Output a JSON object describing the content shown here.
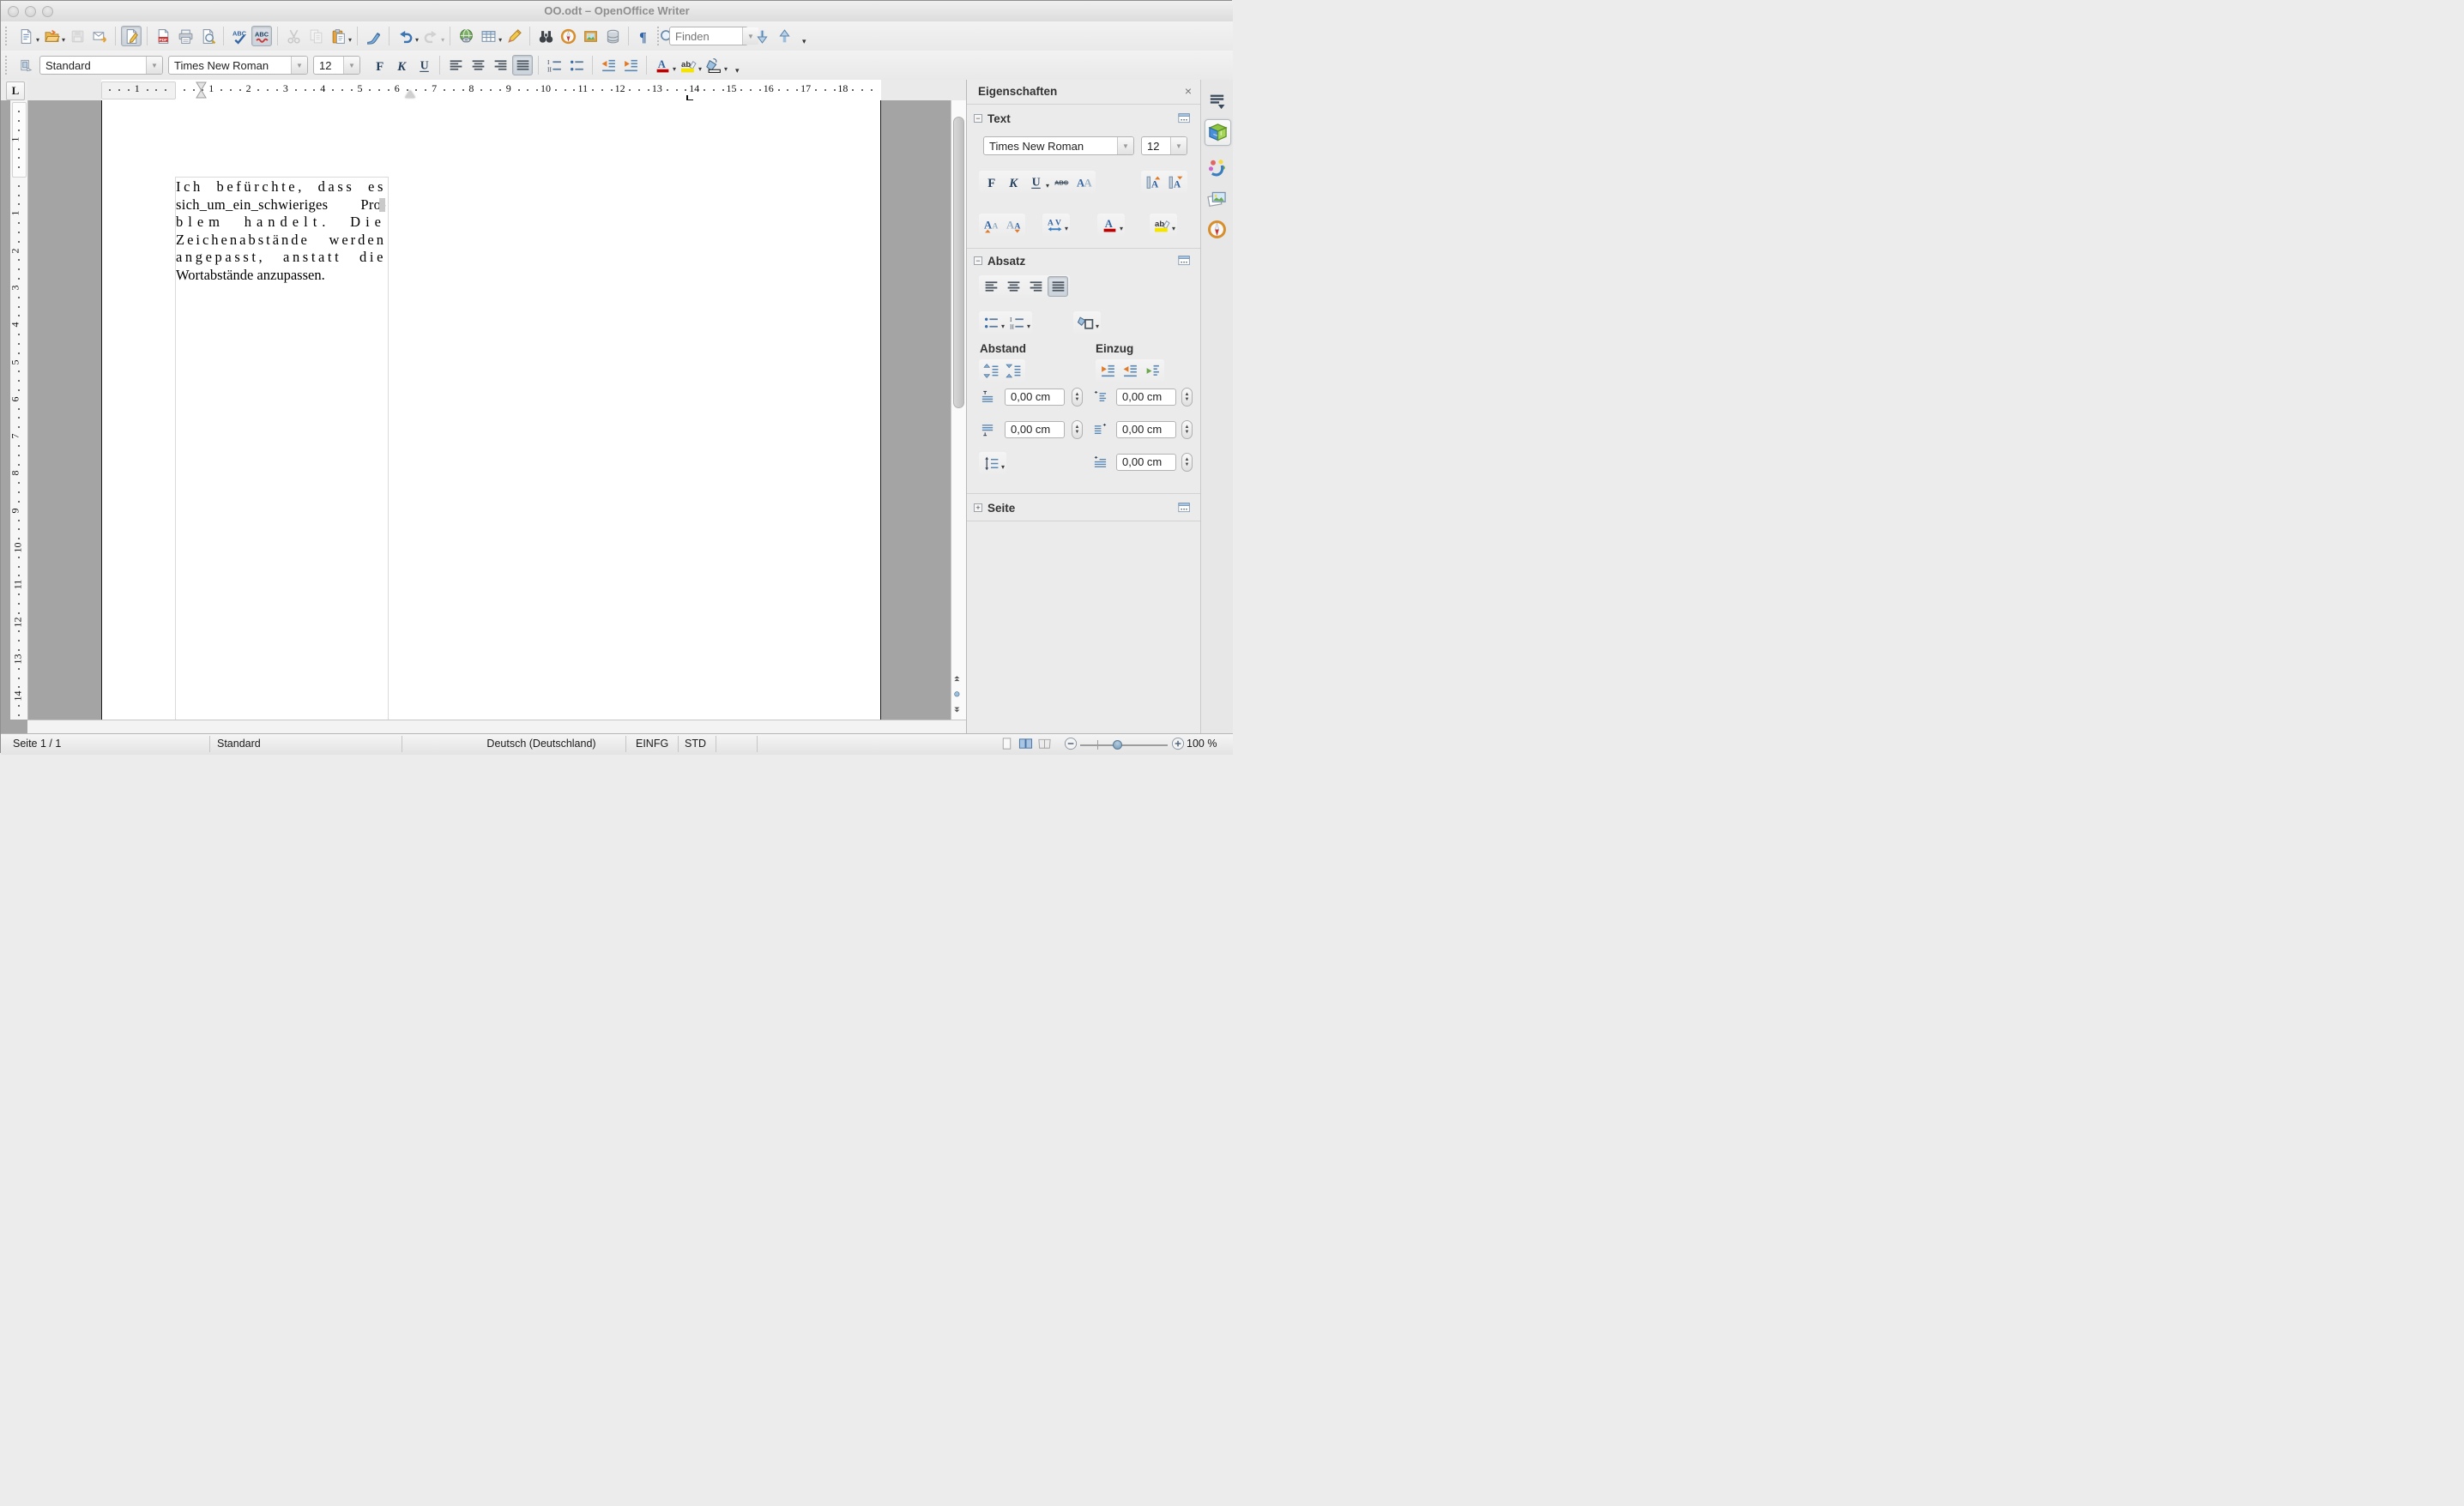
{
  "window": {
    "title": "OO.odt – OpenOffice Writer"
  },
  "toolbar_standard": {
    "buttons": [
      {
        "name": "new-document-button",
        "icon": "new-doc",
        "dropdown": true
      },
      {
        "name": "open-button",
        "icon": "open-folder",
        "dropdown": true
      },
      {
        "name": "save-button",
        "icon": "save-floppy",
        "disabled": true
      },
      {
        "name": "email-document-button",
        "icon": "email"
      },
      {
        "name": "edit-file-button",
        "icon": "edit-file",
        "active": true,
        "sep_before": true
      },
      {
        "name": "export-pdf-button",
        "icon": "pdf-doc",
        "sep_before": true
      },
      {
        "name": "print-button",
        "icon": "printer"
      },
      {
        "name": "page-preview-button",
        "icon": "page-preview"
      },
      {
        "name": "spellcheck-button",
        "icon": "spellcheck",
        "sep_before": true
      },
      {
        "name": "auto-spellcheck-button",
        "icon": "auto-spellcheck",
        "active": true
      },
      {
        "name": "cut-button",
        "icon": "scissors",
        "disabled": true,
        "sep_before": true
      },
      {
        "name": "copy-button",
        "icon": "copy-pages",
        "disabled": true
      },
      {
        "name": "paste-button",
        "icon": "clipboard",
        "dropdown": true
      },
      {
        "name": "clone-formatting-button",
        "icon": "paintbrush",
        "sep_before": true
      },
      {
        "name": "undo-button",
        "icon": "undo-arrow",
        "dropdown": true,
        "sep_before": true
      },
      {
        "name": "redo-button",
        "icon": "redo-arrow",
        "disabled": true,
        "dropdown": true
      },
      {
        "name": "hyperlink-button",
        "icon": "hyperlink-globe",
        "sep_before": true
      },
      {
        "name": "insert-table-button",
        "icon": "table-grid",
        "dropdown": true
      },
      {
        "name": "draw-functions-button",
        "icon": "draw-pencil"
      },
      {
        "name": "find-replace-button",
        "icon": "binoculars",
        "sep_before": true
      },
      {
        "name": "navigator-button",
        "icon": "navigator-compass"
      },
      {
        "name": "gallery-button",
        "icon": "gallery-picture"
      },
      {
        "name": "data-sources-button",
        "icon": "database"
      },
      {
        "name": "formatting-marks-button",
        "icon": "pilcrow",
        "sep_before": true
      },
      {
        "name": "zoom-button",
        "icon": "zoom-lens"
      },
      {
        "name": "help-button",
        "icon": "help-circle",
        "sep_before": true
      }
    ]
  },
  "find_bar": {
    "placeholder": "Finden",
    "buttons": [
      {
        "name": "find-next-button",
        "icon": "arrow-down-blue"
      },
      {
        "name": "find-previous-button",
        "icon": "arrow-up-blue"
      }
    ]
  },
  "toolbar_formatting": {
    "style_value": "Standard",
    "font_value": "Times New Roman",
    "size_value": "12",
    "buttons": [
      {
        "name": "bold-button",
        "icon": "bold-f"
      },
      {
        "name": "italic-button",
        "icon": "italic-k"
      },
      {
        "name": "underline-button",
        "icon": "underline-u"
      },
      {
        "name": "align-left-button",
        "icon": "align-left",
        "sep_before": true
      },
      {
        "name": "align-center-button",
        "icon": "align-center"
      },
      {
        "name": "align-right-button",
        "icon": "align-right"
      },
      {
        "name": "justify-button",
        "icon": "align-justify",
        "active": true
      },
      {
        "name": "numbered-list-button",
        "icon": "numbered-list",
        "sep_before": true
      },
      {
        "name": "bullet-list-button",
        "icon": "bullet-list"
      },
      {
        "name": "decrease-indent-button",
        "icon": "indent-decrease",
        "sep_before": true
      },
      {
        "name": "increase-indent-button",
        "icon": "indent-increase"
      },
      {
        "name": "font-color-button",
        "icon": "font-color",
        "dropdown": true,
        "sep_before": true
      },
      {
        "name": "highlighting-button",
        "icon": "highlight",
        "dropdown": true
      },
      {
        "name": "background-color-button",
        "icon": "paint-can",
        "dropdown": true
      }
    ]
  },
  "ruler": {
    "h_margin_number": "1",
    "h_numbers": [
      "1",
      "2",
      "3",
      "4",
      "5",
      "6",
      "7",
      "8",
      "9",
      "10",
      "11",
      "12",
      "13",
      "14",
      "15",
      "16",
      "17",
      "18"
    ],
    "v_margin_number": "1",
    "v_numbers": [
      "1",
      "2",
      "3",
      "4",
      "5",
      "6",
      "7",
      "8",
      "9",
      "10",
      "11",
      "12",
      "13",
      "14"
    ]
  },
  "document": {
    "lines": [
      {
        "text": "Ich befürchte, dass es",
        "ls": 3.6
      },
      {
        "text": "sich_um_ein_schwieriges Pro-",
        "ls": 0.3,
        "cursor": true
      },
      {
        "text": "blem handelt. Die",
        "ls": 6.0
      },
      {
        "text": "Zeichenabstände werden",
        "ls": 3.0
      },
      {
        "text": "angepasst, anstatt die",
        "ls": 3.6
      },
      {
        "text": "Wortabstände anzupassen.",
        "ls": 0,
        "last": true
      }
    ]
  },
  "sidebar": {
    "title": "Eigenschaften",
    "close_label": "×",
    "tabs": [
      {
        "name": "sidebar-menu-button",
        "icon": "sidebar-menu"
      },
      {
        "name": "tab-properties",
        "icon": "properties-cube",
        "active": true
      },
      {
        "name": "tab-styles",
        "icon": "styles-figures"
      },
      {
        "name": "tab-gallery",
        "icon": "gallery-photos"
      },
      {
        "name": "tab-navigator",
        "icon": "navigator-compass"
      }
    ],
    "text_section": {
      "label": "Text",
      "font_name": "Times New Roman",
      "font_size": "12",
      "buttons_row1": [
        {
          "name": "sidebar-bold-button",
          "icon": "bold-f"
        },
        {
          "name": "sidebar-italic-button",
          "icon": "italic-k"
        },
        {
          "name": "sidebar-underline-button",
          "icon": "underline-u",
          "dropdown": true
        },
        {
          "name": "sidebar-strikethrough-button",
          "icon": "strikethrough"
        },
        {
          "name": "sidebar-character-dialog-button",
          "icon": "char-aa"
        }
      ],
      "buttons_row1b": [
        {
          "name": "sidebar-superscript-button",
          "icon": "superscript"
        },
        {
          "name": "sidebar-subscript-button",
          "icon": "subscript"
        }
      ],
      "buttons_row2a": [
        {
          "name": "sidebar-grow-font-button",
          "icon": "grow-font"
        },
        {
          "name": "sidebar-shrink-font-button",
          "icon": "shrink-font"
        }
      ],
      "buttons_row2b": [
        {
          "name": "sidebar-char-spacing-button",
          "icon": "char-spacing",
          "dropdown": true
        }
      ],
      "buttons_row2c": [
        {
          "name": "sidebar-font-color-button",
          "icon": "font-color",
          "dropdown": true
        }
      ],
      "buttons_row2d": [
        {
          "name": "sidebar-highlighting-button",
          "icon": "highlight",
          "dropdown": true
        }
      ]
    },
    "paragraph_section": {
      "label": "Absatz",
      "align_buttons": [
        {
          "name": "sidebar-align-left-button",
          "icon": "align-left"
        },
        {
          "name": "sidebar-align-center-button",
          "icon": "align-center"
        },
        {
          "name": "sidebar-align-right-button",
          "icon": "align-right"
        },
        {
          "name": "sidebar-justify-button",
          "icon": "align-justify",
          "active": true
        }
      ],
      "list_buttons": [
        {
          "name": "sidebar-bullet-list-button",
          "icon": "bullet-list",
          "dropdown": true
        },
        {
          "name": "sidebar-numbered-list-button",
          "icon": "numbered-list",
          "dropdown": true
        }
      ],
      "bg_buttons": [
        {
          "name": "sidebar-paragraph-background-button",
          "icon": "para-background",
          "dropdown": true
        }
      ],
      "abstand_label": "Abstand",
      "einzug_label": "Einzug",
      "spacing_buttons": [
        {
          "name": "increase-paragraph-spacing-button",
          "icon": "spacing-increase"
        },
        {
          "name": "decrease-paragraph-spacing-button",
          "icon": "spacing-decrease"
        }
      ],
      "indent_buttons": [
        {
          "name": "sidebar-increase-indent-button",
          "icon": "indent-increase"
        },
        {
          "name": "sidebar-decrease-indent-button",
          "icon": "indent-decrease"
        },
        {
          "name": "sidebar-switch-indent-button",
          "icon": "indent-switch"
        }
      ],
      "fields": {
        "spacing_above": "0,00 cm",
        "spacing_below": "0,00 cm",
        "indent_before": "0,00 cm",
        "indent_after": "0,00 cm",
        "first_line_indent": "0,00 cm"
      },
      "line_spacing_button": [
        {
          "name": "line-spacing-button",
          "icon": "line-spacing",
          "dropdown": true
        }
      ]
    },
    "page_section": {
      "label": "Seite"
    }
  },
  "statusbar": {
    "page": "Seite 1 / 1",
    "page_style": "Standard",
    "language": "Deutsch (Deutschland)",
    "insert_mode": "EINFG",
    "selection_mode": "STD",
    "zoom_level": "100 %",
    "view_buttons": [
      {
        "name": "single-page-view-button",
        "icon": "layout-single"
      },
      {
        "name": "multi-page-view-button",
        "icon": "layout-multi",
        "active": true
      },
      {
        "name": "book-view-button",
        "icon": "layout-book"
      }
    ]
  },
  "colors": {
    "accent_blue": "#3465a4",
    "workspace_grey": "#a4a4a4",
    "highlight_yellow": "#f5e400",
    "font_color_red": "#c00000"
  }
}
